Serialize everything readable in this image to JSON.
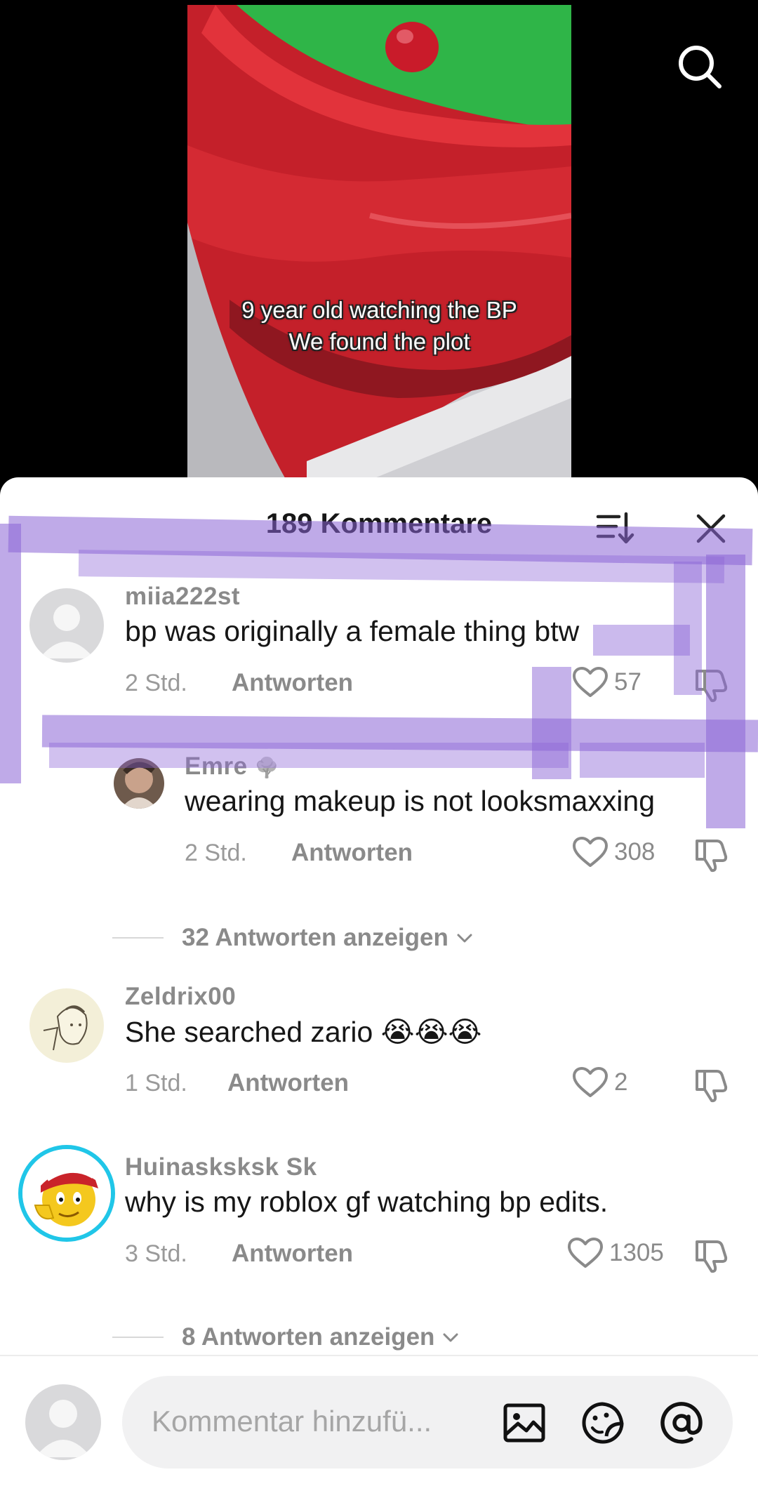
{
  "video": {
    "caption_line1": "9 year old watching the BP",
    "caption_line2": "We found the plot"
  },
  "header": {
    "title": "189 Kommentare"
  },
  "comments": [
    {
      "username": "miia222st",
      "text": "bp was originally a female thing btw",
      "time": "2 Std.",
      "reply_label": "Antworten",
      "likes": "57"
    },
    {
      "username": "Emre",
      "username_icon": "🌳",
      "text": "wearing makeup is not looksmaxxing",
      "time": "2 Std.",
      "reply_label": "Antworten",
      "likes": "308",
      "view_replies": "32 Antworten anzeigen"
    },
    {
      "username": "Zeldrix00",
      "text": "She searched zario",
      "emoji": "😭😭😭",
      "time": "1 Std.",
      "reply_label": "Antworten",
      "likes": "2"
    },
    {
      "username": "Huinasksksk Sk",
      "text": "why is my roblox gf watching bp edits.",
      "time": "3 Std.",
      "reply_label": "Antworten",
      "likes": "1305",
      "view_replies": "8 Antworten anzeigen"
    }
  ],
  "composer": {
    "placeholder": "Kommentar hinzufü..."
  },
  "colors": {
    "highlight": "#8b65d6",
    "avatar_ring": "#20c6e8",
    "text_gray": "#8a8a8a"
  }
}
